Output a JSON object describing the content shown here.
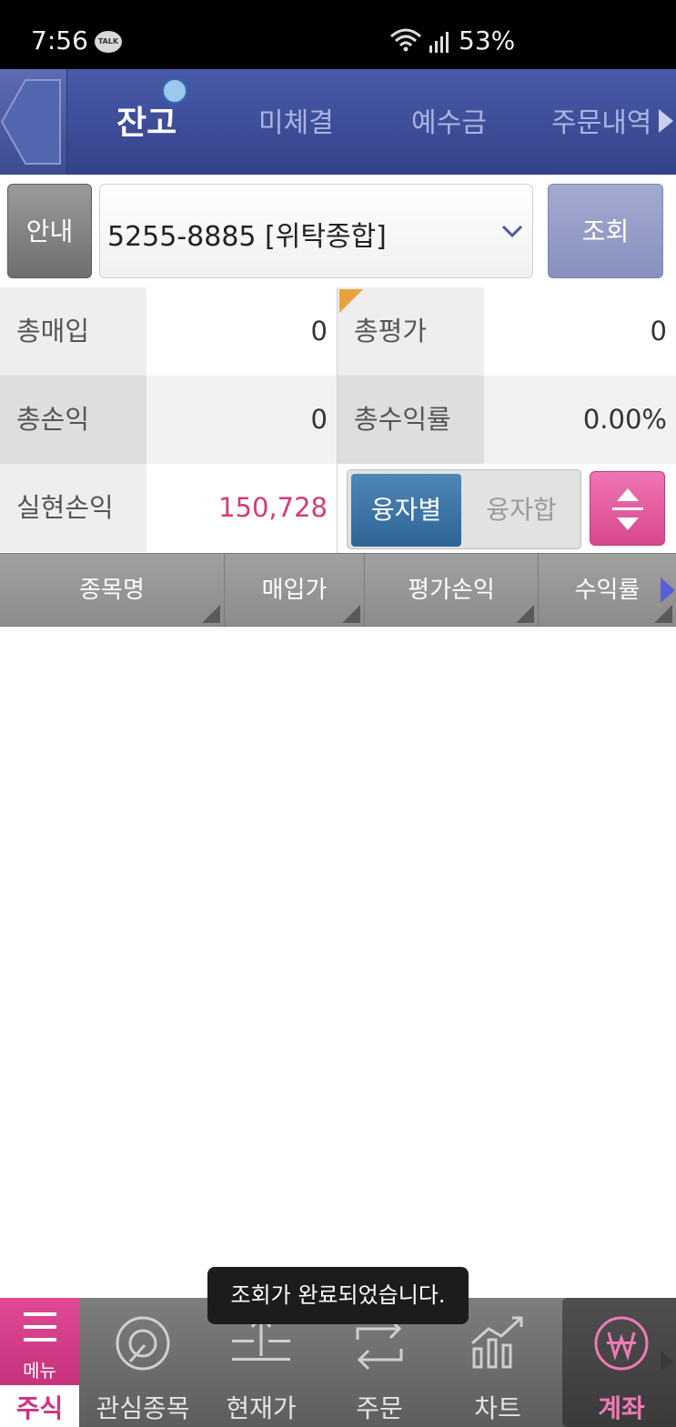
{
  "status_bar": {
    "time": "7:56",
    "talk_badge": "TALK",
    "battery": "53%"
  },
  "tabs": [
    {
      "label": "잔고",
      "active": true
    },
    {
      "label": "미체결"
    },
    {
      "label": "예수금"
    },
    {
      "label": "주문내역"
    }
  ],
  "account": {
    "guide_label": "안내",
    "selected": "5255-8885 [위탁종합]",
    "query_label": "조회"
  },
  "summary": {
    "total_purchase_label": "총매입",
    "total_purchase_value": "0",
    "total_eval_label": "총평가",
    "total_eval_value": "0",
    "total_pl_label": "총손익",
    "total_pl_value": "0",
    "total_return_label": "총수익률",
    "total_return_value": "0.00%",
    "realized_pl_label": "실현손익",
    "realized_pl_value": "150,728",
    "toggle_on_label": "융자별",
    "toggle_off_label": "융자합"
  },
  "columns": [
    "종목명",
    "매입가",
    "평가손익",
    "수익률"
  ],
  "toast": "조회가 완료되었습니다.",
  "bottom_nav": {
    "menu_label": "메뉴",
    "menu_category": "주식",
    "items": [
      {
        "label": "관심종목",
        "icon": "watchlist-icon"
      },
      {
        "label": "현재가",
        "icon": "price-icon"
      },
      {
        "label": "주문",
        "icon": "order-icon"
      },
      {
        "label": "차트",
        "icon": "chart-icon"
      },
      {
        "label": "계좌",
        "icon": "account-won-icon",
        "active": true
      }
    ]
  },
  "colors": {
    "accent_blue": "#3c4b92",
    "accent_pink": "#d8478c",
    "profit": "#d63a7a"
  }
}
